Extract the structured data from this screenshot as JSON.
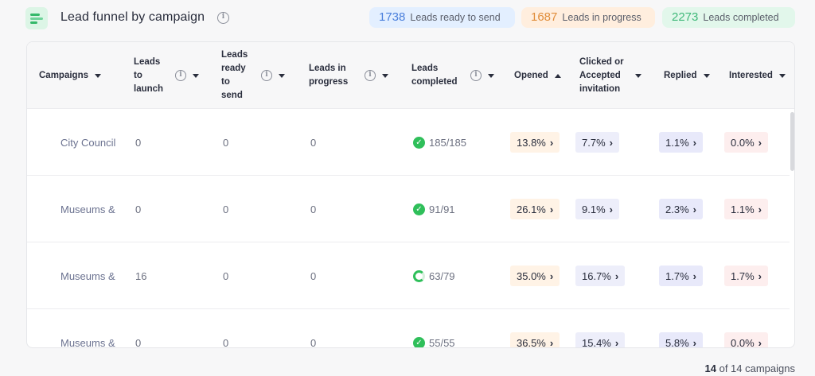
{
  "header": {
    "title": "Lead funnel by campaign",
    "stats": [
      {
        "value": "1738",
        "label": "Leads ready to send",
        "color": "#4a7fdc"
      },
      {
        "value": "1687",
        "label": "Leads in progress",
        "color": "#e08d3a"
      },
      {
        "value": "2273",
        "label": "Leads completed",
        "color": "#3fb879"
      }
    ]
  },
  "table": {
    "columns": [
      {
        "label": "Campaigns",
        "sort": "caret-down-icon"
      },
      {
        "label": "Leads to launch",
        "sort": "caret-down-icon",
        "info": true
      },
      {
        "label": "Leads ready to send",
        "sort": "caret-down-icon",
        "info": true
      },
      {
        "label": "Leads in progress",
        "sort": "caret-down-icon",
        "info": true
      },
      {
        "label": "Leads completed",
        "sort": "caret-down-icon",
        "info": true
      },
      {
        "label": "Opened",
        "sort": "caret-up-icon"
      },
      {
        "label": "Clicked or Accepted invitation",
        "sort": "caret-down-icon"
      },
      {
        "label": "Replied",
        "sort": "caret-down-icon"
      },
      {
        "label": "Interested",
        "sort": "caret-down-icon"
      }
    ],
    "rows": [
      {
        "campaign": "City Council",
        "to_launch": "0",
        "ready": "0",
        "in_progress": "0",
        "completed": "185/185",
        "status_icon": "check-circle-icon",
        "opened": "13.8%",
        "clicked": "7.7%",
        "replied": "1.1%",
        "interested": "0.0%"
      },
      {
        "campaign": "Museums &",
        "to_launch": "0",
        "ready": "0",
        "in_progress": "0",
        "completed": "91/91",
        "status_icon": "check-circle-icon",
        "opened": "26.1%",
        "clicked": "9.1%",
        "replied": "2.3%",
        "interested": "1.1%"
      },
      {
        "campaign": "Museums &",
        "to_launch": "16",
        "ready": "0",
        "in_progress": "0",
        "completed": "63/79",
        "status_icon": "progress-ring-icon",
        "opened": "35.0%",
        "clicked": "16.7%",
        "replied": "1.7%",
        "interested": "1.7%"
      },
      {
        "campaign": "Museums &",
        "to_launch": "0",
        "ready": "0",
        "in_progress": "0",
        "completed": "55/55",
        "status_icon": "check-circle-icon",
        "opened": "36.5%",
        "clicked": "15.4%",
        "replied": "5.8%",
        "interested": "0.0%"
      }
    ]
  },
  "footer": {
    "count": "14",
    "text": "of 14 campaigns"
  }
}
